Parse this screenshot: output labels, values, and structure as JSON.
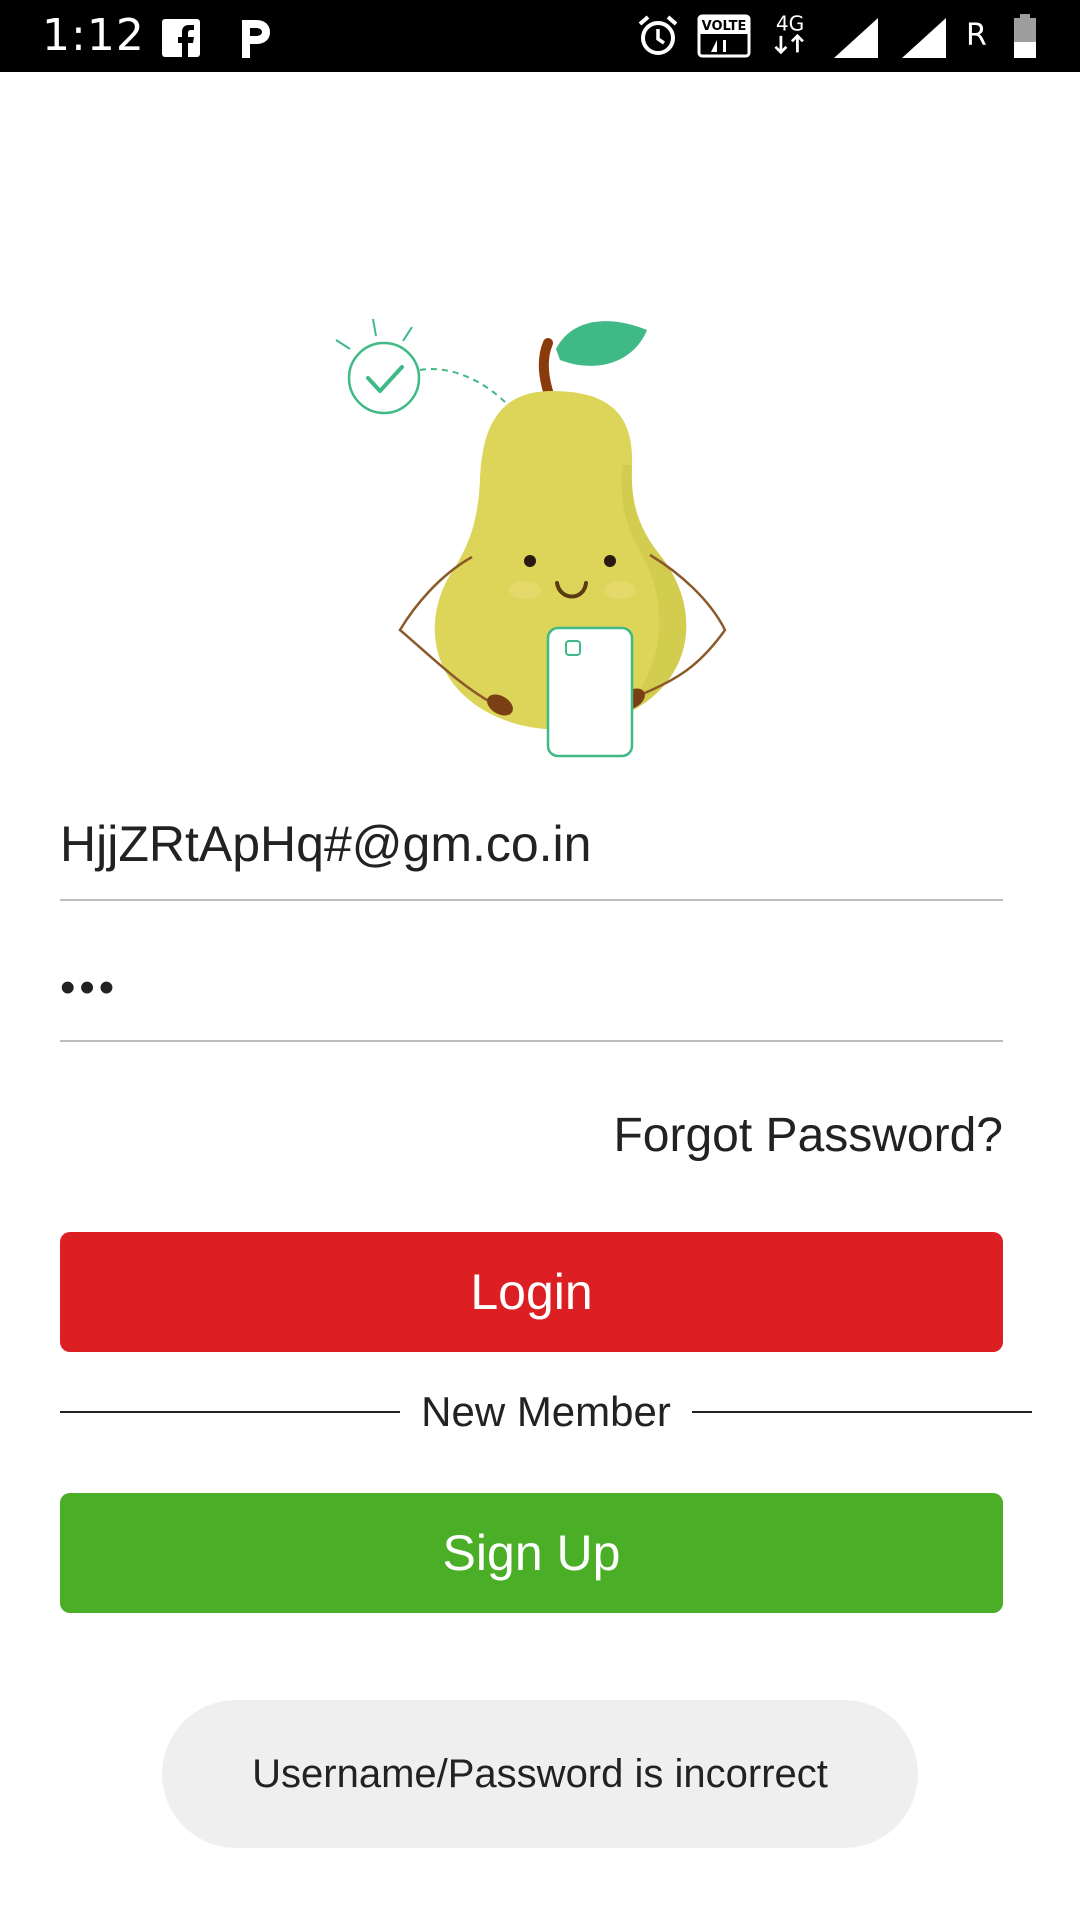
{
  "status_bar": {
    "time": "1:12",
    "icons": [
      "facebook-icon",
      "p-app-icon",
      "alarm-icon",
      "volte-icon",
      "4g-icon",
      "signal-icon",
      "signal-icon",
      "battery-icon"
    ],
    "volte": "VOLTE",
    "network": "4G",
    "roaming": "R"
  },
  "login_form": {
    "email_value": "HjjZRtApHq#@gm.co.in",
    "password_value": "•••",
    "forgot_password_label": "Forgot Password?",
    "login_label": "Login",
    "divider_label": "New Member",
    "signup_label": "Sign Up"
  },
  "toast": {
    "message": "Username/Password is incorrect"
  },
  "colors": {
    "login": "#db1f23",
    "signup": "#4aae27",
    "pear": "#dcd55a",
    "leaf": "#3fb985"
  }
}
